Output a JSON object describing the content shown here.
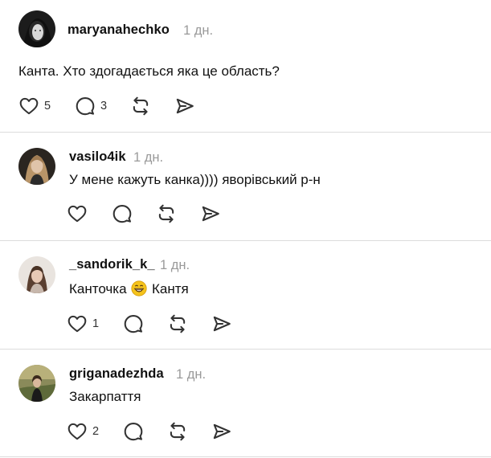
{
  "posts": [
    {
      "username": "maryanahechko",
      "time": "1 дн.",
      "text": "Канта. Хто здогадається яка це область?",
      "likes": "5",
      "replies": "3"
    },
    {
      "username": "vasilo4ik",
      "time": "1 дн.",
      "text": "У мене кажуть канка)))) яворівський р-н",
      "likes": "",
      "replies": ""
    },
    {
      "username": "_sandorik_k_",
      "time": "1 дн.",
      "text_before": "Канточка",
      "text_emoji": "😁",
      "text_after": "Кантя",
      "likes": "1",
      "replies": ""
    },
    {
      "username": "griganadezhda",
      "time": "1 дн.",
      "text": "Закарпаття",
      "likes": "2",
      "replies": ""
    }
  ],
  "icons": {
    "like": "heart-icon",
    "reply": "comment-icon",
    "repost": "repost-icon",
    "share": "send-icon",
    "emoji": "grinning-face-emoji"
  },
  "colors": {
    "text": "#111111",
    "muted": "#9a9a9a",
    "divider": "#dcdcdc",
    "icon": "#333333"
  }
}
